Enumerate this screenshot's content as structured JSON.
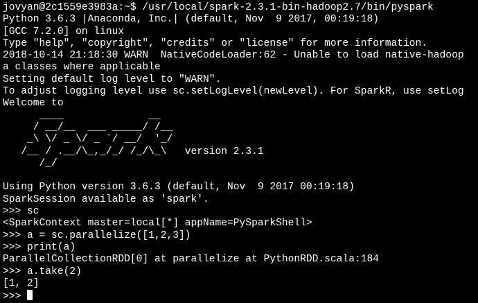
{
  "terminal": {
    "lines": [
      "jovyan@2c1559e3983a:~$ /usr/local/spark-2.3.1-bin-hadoop2.7/bin/pyspark",
      "Python 3.6.3 |Anaconda, Inc.| (default, Nov  9 2017, 00:19:18)",
      "[GCC 7.2.0] on linux",
      "Type \"help\", \"copyright\", \"credits\" or \"license\" for more information.",
      "2018-10-14 21:18:30 WARN  NativeCodeLoader:62 - Unable to load native-hadoop",
      "a classes where applicable",
      "Setting default log level to \"WARN\".",
      "To adjust logging level use sc.setLogLevel(newLevel). For SparkR, use setLog",
      "Welcome to",
      "      ____              __",
      "     / __/__  ___ _____/ /__",
      "    _\\ \\/ _ \\/ _ `/ __/  '_/",
      "   /__ / .__/\\_,_/_/ /_/\\_\\   version 2.3.1",
      "      /_/",
      "",
      "Using Python version 3.6.3 (default, Nov  9 2017 00:19:18)",
      "SparkSession available as 'spark'.",
      ">>> sc",
      "<SparkContext master=local[*] appName=PySparkShell>",
      ">>> a = sc.parallelize([1,2,3])",
      ">>> print(a)",
      "ParallelCollectionRDD[0] at parallelize at PythonRDD.scala:184",
      ">>> a.take(2)",
      "[1, 2]"
    ],
    "prompt": ">>> "
  }
}
